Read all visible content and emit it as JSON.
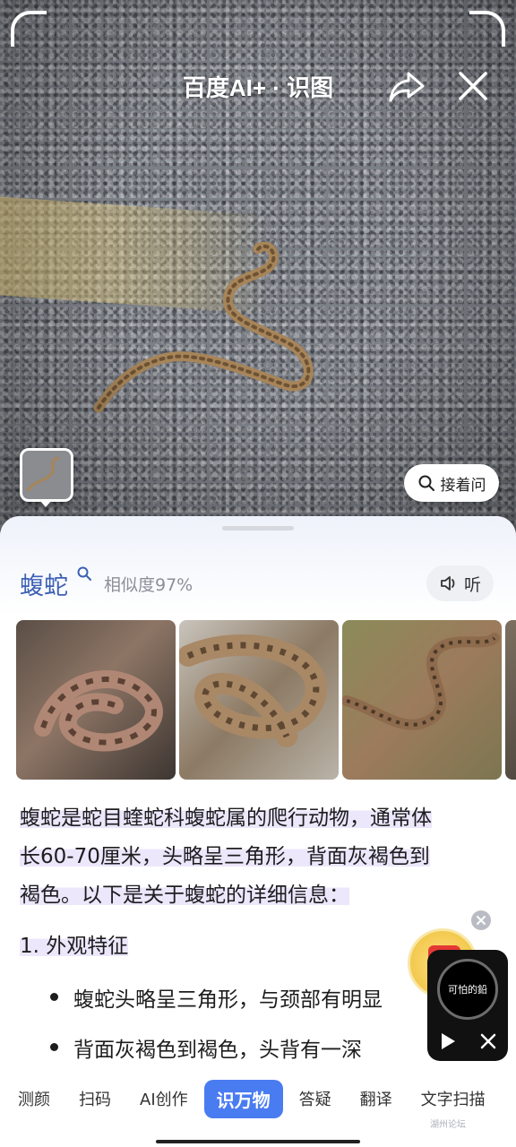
{
  "header": {
    "brand": "百度AI+ · 识图"
  },
  "photo": {
    "ask_button": "接着问"
  },
  "result": {
    "name": "蝮蛇",
    "similarity": "相似度97%",
    "listen_button": "听",
    "description_lines": [
      "蝮蛇是蛇目蝰蛇科蝮蛇属的爬行动物，通常体",
      "长60-70厘米，头略呈三角形，背面灰褐色到",
      "褐色。以下是关于蝮蛇的详细信息："
    ],
    "section_1": "1. 外观特征",
    "bullets": [
      "蝮蛇头略呈三角形，与颈部有明显",
      "背面灰褐色到褐色，头背有一深"
    ]
  },
  "media_widget": {
    "disc_text": "可怕的鉛"
  },
  "tabs": [
    {
      "label": "测颜",
      "active": false
    },
    {
      "label": "扫码",
      "active": false
    },
    {
      "label": "AI创作",
      "active": false
    },
    {
      "label": "识万物",
      "active": true
    },
    {
      "label": "答疑",
      "active": false
    },
    {
      "label": "翻译",
      "active": false
    },
    {
      "label": "文字扫描",
      "active": false
    }
  ],
  "watermark": "湖州论坛",
  "colors": {
    "accent": "#4a7cf1",
    "title": "#3b5fb5",
    "highlight": "#ece7fb"
  }
}
